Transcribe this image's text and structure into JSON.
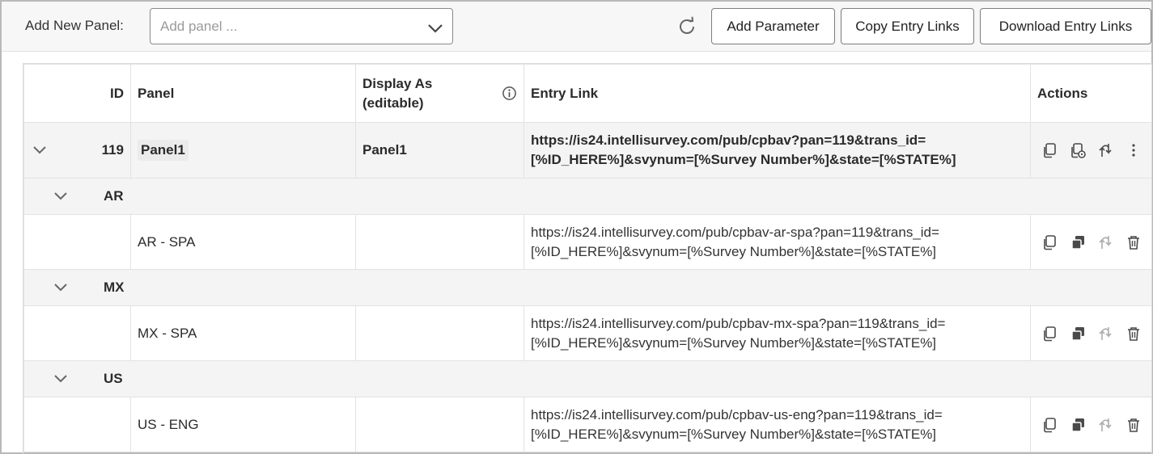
{
  "toolbar": {
    "add_panel_label": "Add New Panel:",
    "add_panel_placeholder": "Add panel ...",
    "refresh_icon": "refresh-icon",
    "add_parameter_label": "Add Parameter",
    "copy_entry_links_label": "Copy Entry Links",
    "download_entry_links_label": "Download Entry Links"
  },
  "table": {
    "headers": {
      "id": "ID",
      "panel": "Panel",
      "display_as": "Display As\n(editable)",
      "entry_link": "Entry Link",
      "actions": "Actions"
    },
    "parent": {
      "id": "119",
      "panel": "Panel1",
      "display_as": "Panel1",
      "entry_link": "https://is24.intellisurvey.com/pub/cpbav?pan=119&trans_id=[%ID_HERE%]&svynum=[%Survey Number%]&state=[%STATE%]",
      "entry_link_line1": "https://is24.intellisurvey.com/pub/cpbav?pan=119&trans_id=",
      "entry_link_line2": "[%ID_HERE%]&svynum=[%Survey Number%]&state=[%STATE%]"
    },
    "groups": [
      {
        "name": "AR",
        "child": {
          "panel": "AR - SPA",
          "link_line1": "https://is24.intellisurvey.com/pub/cpbav-ar-spa?pan=119&trans_id=",
          "link_line2": "[%ID_HERE%]&svynum=[%Survey Number%]&state=[%STATE%]"
        }
      },
      {
        "name": "MX",
        "child": {
          "panel": "MX - SPA",
          "link_line1": "https://is24.intellisurvey.com/pub/cpbav-mx-spa?pan=119&trans_id=",
          "link_line2": "[%ID_HERE%]&svynum=[%Survey Number%]&state=[%STATE%]"
        }
      },
      {
        "name": "US",
        "child": {
          "panel": "US - ENG",
          "link_line1": "https://is24.intellisurvey.com/pub/cpbav-us-eng?pan=119&trans_id=",
          "link_line2": "[%ID_HERE%]&svynum=[%Survey Number%]&state=[%STATE%]"
        }
      }
    ]
  },
  "colors": {
    "row_shade": "#f4f4f4",
    "border": "#e2e2e2",
    "icon": "#4a4a4a"
  }
}
